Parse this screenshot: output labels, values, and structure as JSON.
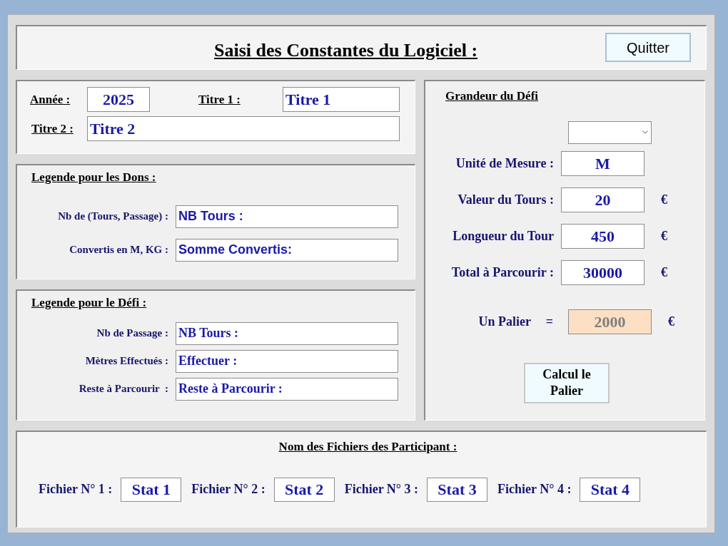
{
  "header": {
    "title": "Saisi des Constantes du Logiciel :",
    "quit_button": "Quitter"
  },
  "general": {
    "year_label": "Année :",
    "year": "2025",
    "title1_label": "Titre 1 :",
    "title1": "Titre 1",
    "title2_label": "Titre 2 :",
    "title2": "Titre 2"
  },
  "donations_legend": {
    "heading": "Legende pour les Dons :",
    "fields": [
      {
        "label": "Nb de (Tours, Passage) :",
        "value": "NB Tours :"
      },
      {
        "label": "Convertis en M, KG :",
        "value": "Somme Convertis:"
      }
    ]
  },
  "challenge_legend": {
    "heading": "Legende pour le Défi :",
    "fields": [
      {
        "label": "Nb de Passage :",
        "value": "NB Tours :"
      },
      {
        "label": "Mètres Effectués :",
        "value": "Effectuer :"
      },
      {
        "label": "Reste à Parcourir  :",
        "value": "Reste à Parcourir :"
      }
    ]
  },
  "challenge_size": {
    "heading": "Grandeur du Défi",
    "fields": [
      {
        "label": "Unité de Mesure :",
        "value": "M"
      },
      {
        "label": "Valeur du Tours :",
        "value": "20",
        "unit": "€"
      },
      {
        "label": "Longueur du Tour",
        "value": "450",
        "unit": "€"
      },
      {
        "label": "Total à Parcourir :",
        "value": "30000",
        "unit": "€"
      }
    ],
    "step": {
      "label": "Un Palier",
      "equals": "=",
      "value": "2000",
      "unit": "€",
      "disabled": true
    },
    "calc_button": "Calcul le Palier"
  },
  "participant_files": {
    "heading": "Nom des Fichiers des Participant :",
    "files": [
      {
        "label": "Fichier N° 1 :",
        "value": "Stat 1"
      },
      {
        "label": "Fichier N° 2 :",
        "value": "Stat 2"
      },
      {
        "label": "Fichier N° 3 :",
        "value": "Stat 3"
      },
      {
        "label": "Fichier N° 4 :",
        "value": "Stat 4"
      }
    ]
  }
}
